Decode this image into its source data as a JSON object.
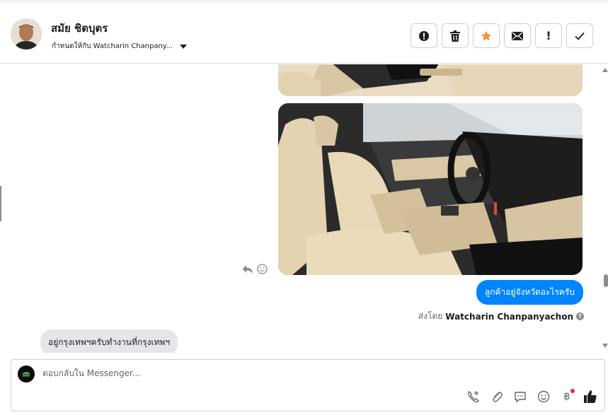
{
  "header": {
    "contact_name": "สมัย ชิตบุตร",
    "assigned_to": "กำหนดให้กับ Watcharin Chanpany..."
  },
  "actions": [
    {
      "name": "mark-spam",
      "glyph": "!"
    },
    {
      "name": "delete",
      "glyph": ""
    },
    {
      "name": "star",
      "glyph": ""
    },
    {
      "name": "mark-unread",
      "glyph": ""
    },
    {
      "name": "follow-up",
      "glyph": "!"
    },
    {
      "name": "mark-done",
      "glyph": ""
    }
  ],
  "thread": {
    "outgoing_message": "ลูกค้าอยู่จังหวัดอะไรครับ",
    "sent_by_prefix": "ส่งโดย",
    "sent_by_name": "Watcharin Chanpanyachon",
    "incoming_message": "อยู่กรุงเทพฯครับทำงานที่กรุงเทพฯ"
  },
  "composer": {
    "placeholder": "ตอบกลับใน Messenger...",
    "tools": [
      "phone-add-icon",
      "attachment-icon",
      "saved-reply-icon",
      "emoji-icon",
      "baht-icon",
      "like-icon"
    ],
    "baht_glyph": "฿"
  },
  "colors": {
    "accent": "#0084ff",
    "star": "#f7923a",
    "notification": "#f02849"
  }
}
